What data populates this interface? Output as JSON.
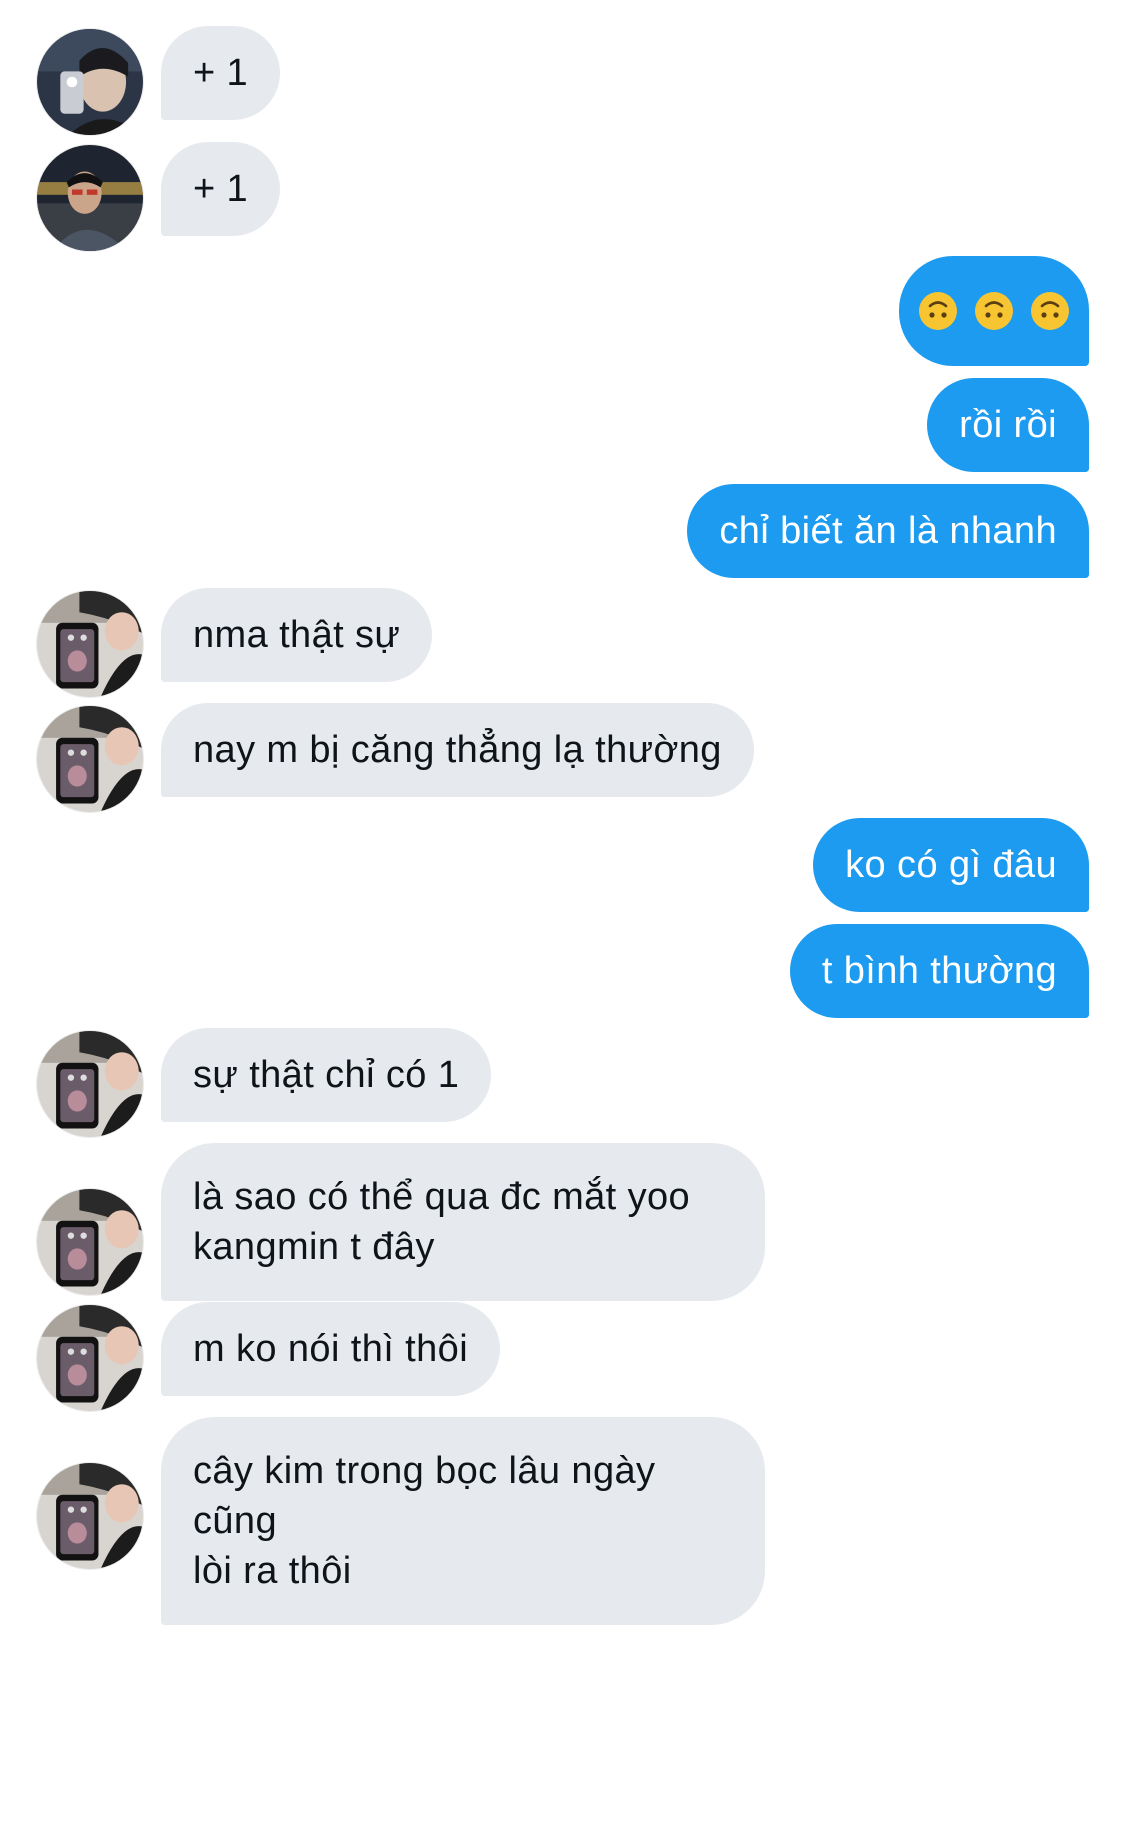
{
  "colors": {
    "incoming_bubble": "#e6e9ee",
    "outgoing_bubble": "#1d9bf0",
    "incoming_text": "#0f1419",
    "outgoing_text": "#ffffff",
    "background": "#ffffff"
  },
  "messages": [
    {
      "direction": "incoming",
      "avatar": "avatar-user-mirror-selfie",
      "text": "+ 1"
    },
    {
      "direction": "incoming",
      "avatar": "avatar-user-outdoor-night",
      "text": "+ 1"
    },
    {
      "direction": "outgoing",
      "emojis": [
        "upside-down-face-icon",
        "upside-down-face-icon",
        "upside-down-face-icon"
      ]
    },
    {
      "direction": "outgoing",
      "text": "rồi rồi"
    },
    {
      "direction": "outgoing",
      "text": "chỉ biết ăn là nhanh"
    },
    {
      "direction": "incoming",
      "avatar": "avatar-user-phone-selfie",
      "text": "nma thật sự"
    },
    {
      "direction": "incoming",
      "avatar": "avatar-user-phone-selfie",
      "text": "nay m bị căng thẳng lạ thường"
    },
    {
      "direction": "outgoing",
      "text": "ko có gì đâu"
    },
    {
      "direction": "outgoing",
      "text": "t bình thường"
    },
    {
      "direction": "incoming",
      "avatar": "avatar-user-phone-selfie",
      "text": "sự thật chỉ có 1"
    },
    {
      "direction": "incoming",
      "avatar": "avatar-user-phone-selfie",
      "lines": [
        "là sao có thể qua đc mắt yoo",
        "kangmin t đây"
      ]
    },
    {
      "direction": "incoming",
      "avatar": "avatar-user-phone-selfie",
      "text": "m ko nói thì thôi"
    },
    {
      "direction": "incoming",
      "avatar": "avatar-user-phone-selfie",
      "lines": [
        "cây kim trong bọc lâu ngày cũng",
        "lòi ra thôi"
      ]
    }
  ]
}
